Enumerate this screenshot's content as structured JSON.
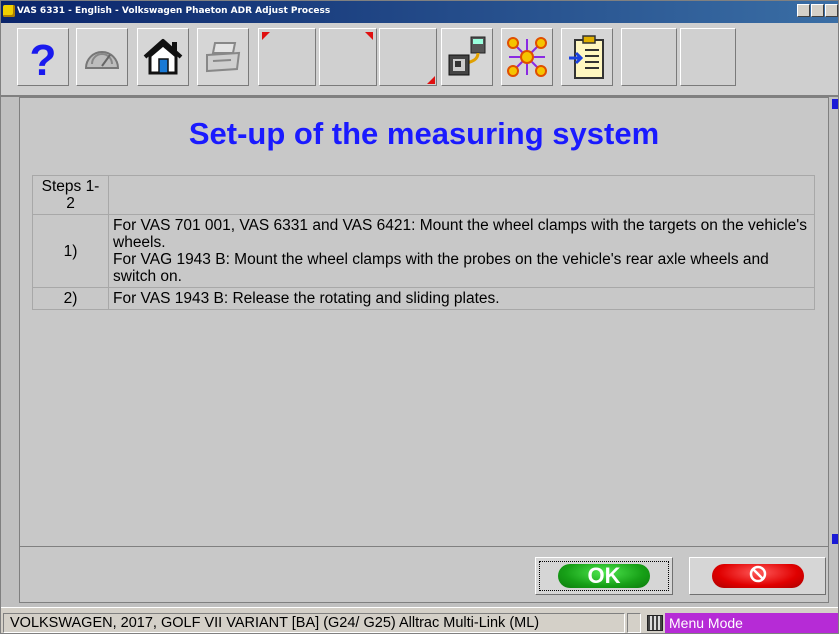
{
  "window": {
    "title": "VAS 6331 - English  -  Volkswagen Phaeton ADR Adjust Process"
  },
  "toolbar": {
    "buttons": [
      {
        "name": "help",
        "icon": "question-mark-icon"
      },
      {
        "name": "gauge",
        "icon": "speedometer-icon"
      },
      {
        "name": "home",
        "icon": "house-icon"
      },
      {
        "name": "print",
        "icon": "printer-icon"
      },
      {
        "name": "empty-1",
        "icon": ""
      },
      {
        "name": "empty-2",
        "icon": ""
      },
      {
        "name": "empty-3",
        "icon": ""
      },
      {
        "name": "device",
        "icon": "measuring-device-icon"
      },
      {
        "name": "network",
        "icon": "network-nodes-icon"
      },
      {
        "name": "clipboard",
        "icon": "clipboard-icon"
      },
      {
        "name": "empty-4",
        "icon": ""
      },
      {
        "name": "empty-5",
        "icon": ""
      }
    ]
  },
  "main": {
    "heading": "Set-up of the measuring system",
    "steps_header": "Steps 1-\n2",
    "steps": [
      {
        "num": "1)",
        "text": "For VAS 701 001, VAS 6331 and VAS 6421: Mount the wheel clamps with the targets on the vehicle's wheels.\nFor VAG 1943 B: Mount the wheel clamps with the probes on the vehicle's rear axle wheels and switch on."
      },
      {
        "num": "2)",
        "text": "For VAS 1943 B: Release the rotating and sliding plates."
      }
    ]
  },
  "buttons": {
    "ok_label": "OK",
    "cancel_icon": "no-entry-icon"
  },
  "status": {
    "vehicle": "VOLKSWAGEN, 2017, GOLF VII VARIANT [BA] (G24/ G25) Alltrac Multi-Link (ML)",
    "mode": "Menu Mode"
  },
  "colors": {
    "heading": "#1a1aff",
    "ok": "#17a017",
    "cancel": "#e00000",
    "mode_badge": "#b62bd6"
  }
}
